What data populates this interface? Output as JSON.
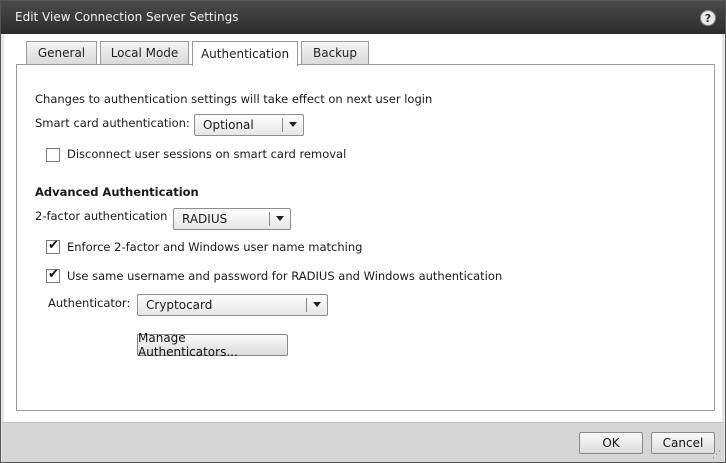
{
  "dialog": {
    "title": "Edit View Connection Server Settings",
    "help_label": "?"
  },
  "tabs": [
    {
      "label": "General",
      "active": false
    },
    {
      "label": "Local Mode",
      "active": false
    },
    {
      "label": "Authentication",
      "active": true
    },
    {
      "label": "Backup",
      "active": false
    }
  ],
  "auth": {
    "notice": "Changes to authentication settings will take effect on next user login",
    "smart_card_label": "Smart card authentication:",
    "smart_card_value": "Optional",
    "disconnect_label": "Disconnect user sessions on smart card removal",
    "disconnect_checked": false,
    "advanced_heading": "Advanced Authentication",
    "two_factor_label": "2-factor authentication",
    "two_factor_value": "RADIUS",
    "enforce_label": "Enforce 2-factor and Windows user name matching",
    "enforce_checked": true,
    "same_creds_label": "Use same username and password for RADIUS and Windows authentication",
    "same_creds_checked": true,
    "authenticator_label": "Authenticator:",
    "authenticator_value": "Cryptocard",
    "manage_button": "Manage Authenticators..."
  },
  "footer": {
    "ok_label": "OK",
    "cancel_label": "Cancel"
  },
  "icons": {
    "check": "✔",
    "grip": "⋰"
  }
}
